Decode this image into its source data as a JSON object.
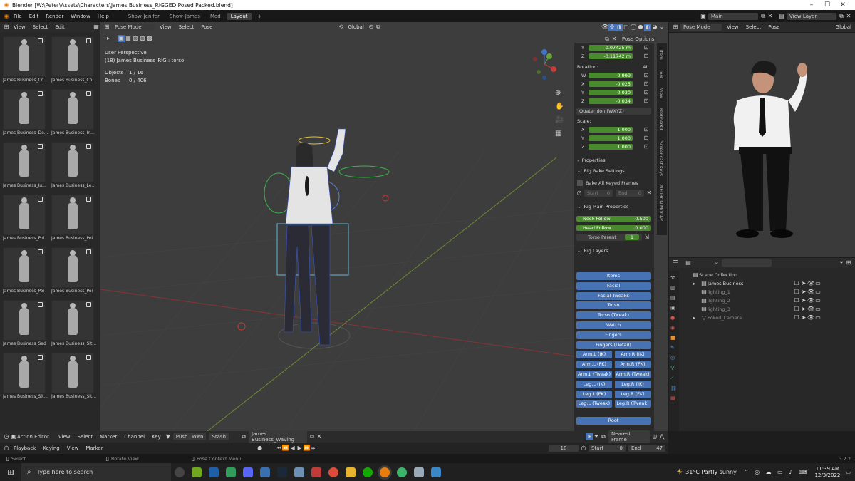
{
  "window": {
    "title": "Blender [W:\\Peter\\Assets\\Characters\\James Business_RIGGED Posed Packed.blend]"
  },
  "menu": {
    "items": [
      "File",
      "Edit",
      "Render",
      "Window",
      "Help"
    ],
    "tabs": [
      "Show-Jenifer",
      "Show-James",
      "Mod",
      "Layout"
    ],
    "active_tab": "Layout",
    "add": "+"
  },
  "scene": {
    "name": "Main",
    "view_layer": "View Layer"
  },
  "browser": {
    "header": [
      "View",
      "Select",
      "Edit"
    ],
    "thumbs": [
      "James Business_Co...",
      "James Business_Co...",
      "James Business_De...",
      "James Business_In...",
      "James Business_Ju...",
      "James Business_Le...",
      "James Business_Poi",
      "James Business_Poi",
      "James Business_Poi",
      "James Business_Poi",
      "James Business_Sad",
      "James Business_Sit...",
      "James Business_Sit...",
      "James Business_Sit..."
    ]
  },
  "viewport": {
    "mode": "Pose Mode",
    "header": [
      "View",
      "Select",
      "Pose"
    ],
    "orientation": "Global",
    "pose_options": "Pose Options",
    "perspective": "User Perspective",
    "object": "(18) James Business_RIG : torso",
    "objects_label": "Objects",
    "objects_value": "1 / 16",
    "bones_label": "Bones",
    "bones_value": "0 / 406"
  },
  "npanel": {
    "loc_y_label": "Y",
    "loc_y": "-0.07425 m",
    "loc_z_label": "Z",
    "loc_z": "-0.11742 m",
    "rotation_label": "Rotation:",
    "rotation_mode_short": "4L",
    "rot": [
      {
        "axis": "W",
        "value": "0.999"
      },
      {
        "axis": "X",
        "value": "-0.025"
      },
      {
        "axis": "Y",
        "value": "-0.030"
      },
      {
        "axis": "Z",
        "value": "-0.034"
      }
    ],
    "rotation_mode": "Quaternion (WXYZ)",
    "scale_label": "Scale:",
    "scale": [
      {
        "axis": "X",
        "value": "1.000"
      },
      {
        "axis": "Y",
        "value": "1.000"
      },
      {
        "axis": "Z",
        "value": "1.000"
      }
    ],
    "properties": "Properties",
    "rig_bake": "Rig Bake Settings",
    "bake_all": "Bake All Keyed Frames",
    "start": "Start",
    "start_val": "0",
    "end": "End",
    "end_val": "0",
    "rig_main": "Rig Main Properties",
    "neck_follow": "Neck Follow",
    "neck_val": "0.500",
    "head_follow": "Head Follow",
    "head_val": "0.000",
    "torso_parent": "Torso Parent",
    "torso_val": "1",
    "rig_layers": "Rig Layers",
    "layers_full": [
      "Items",
      "Facial",
      "Facial Tweaks",
      "Torso",
      "Torso (Tweak)",
      "Watch",
      "Fingers",
      "Fingers (Detail)"
    ],
    "layers_pair": [
      [
        "Arm.L (IK)",
        "Arm.R (IK)"
      ],
      [
        "Arm.L (FK)",
        "Arm.R (FK)"
      ],
      [
        "Arm.L (Tweak)",
        "Arm.R (Tweak)"
      ],
      [
        "Leg.L (IK)",
        "Leg.R (IK)"
      ],
      [
        "Leg.L (FK)",
        "Leg.R (FK)"
      ],
      [
        "Leg.L (Tweak)",
        "Leg.R (Tweak)"
      ]
    ],
    "root": "Root"
  },
  "vtabs": [
    "Item",
    "Tool",
    "View",
    "BlenderKit",
    "Screencast Keys",
    "NEURON MOCAP"
  ],
  "right_view": {
    "mode": "Pose Mode",
    "header": [
      "View",
      "Select",
      "Pose"
    ],
    "orientation": "Global"
  },
  "outliner": {
    "root": "Scene Collection",
    "items": [
      {
        "name": "James Business"
      },
      {
        "name": "lighting_1"
      },
      {
        "name": "lighting_2"
      },
      {
        "name": "lighting_3"
      },
      {
        "name": "Poked_Camera"
      }
    ]
  },
  "timeline": {
    "editor": "Action Editor",
    "header": [
      "View",
      "Select",
      "Marker",
      "Channel",
      "Key"
    ],
    "push_down": "Push Down",
    "stash": "Stash",
    "action": "James Business_Waving",
    "snap": "Nearest Frame",
    "row2": [
      "Playback",
      "Keying",
      "View",
      "Marker"
    ],
    "frame": "18",
    "start_label": "Start",
    "start": "0",
    "end_label": "End",
    "end": "47"
  },
  "status": {
    "select": "Select",
    "rotate": "Rotate View",
    "context": "Pose Context Menu",
    "version": "3.2.2"
  },
  "taskbar": {
    "search": "Type here to search",
    "weather": "31°C  Partly sunny",
    "time": "11:39 AM",
    "date": "12/3/2022"
  }
}
